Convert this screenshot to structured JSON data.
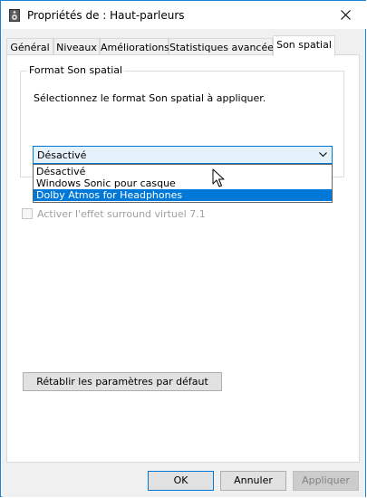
{
  "window": {
    "title": "Propriétés de : Haut-parleurs"
  },
  "tabs": [
    {
      "label": "Général"
    },
    {
      "label": "Niveaux"
    },
    {
      "label": "Améliorations"
    },
    {
      "label": "Statistiques avancées"
    },
    {
      "label": "Son spatial",
      "active": true
    }
  ],
  "spatial": {
    "group_title": "Format Son spatial",
    "description": "Sélectionnez le format Son spatial à appliquer.",
    "selected_value": "Désactivé",
    "options": [
      "Désactivé",
      "Windows Sonic pour casque",
      "Dolby Atmos for Headphones"
    ],
    "highlighted_option": "Dolby Atmos for Headphones",
    "surround_label": "Activer l'effet surround virtuel 7.1",
    "surround_checked": false,
    "surround_enabled": false,
    "reset_label": "Rétablir les paramètres par défaut"
  },
  "footer": {
    "ok_label": "OK",
    "cancel_label": "Annuler",
    "apply_label": "Appliquer"
  },
  "colors": {
    "accent": "#0078d7",
    "border": "#1883d7",
    "client_bg": "#f0f0f0"
  },
  "icons": {
    "app": "speaker-icon",
    "close": "close-icon",
    "dropdown": "chevron-down-icon",
    "cursor": "mouse-pointer-icon"
  }
}
